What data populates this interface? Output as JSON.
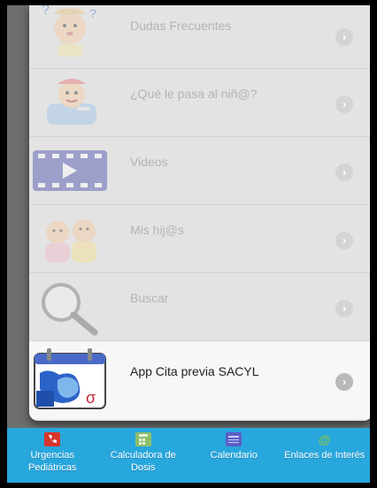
{
  "menu": {
    "items": [
      {
        "label": "Dudas Frecuentes",
        "icon": "baby-thinking-icon"
      },
      {
        "label": "¿Qué le pasa al niñ@?",
        "icon": "sick-baby-icon"
      },
      {
        "label": "Videos",
        "icon": "video-film-icon"
      },
      {
        "label": "Mis hij@s",
        "icon": "children-icon"
      },
      {
        "label": "Buscar",
        "icon": "magnifier-icon"
      },
      {
        "label": "App Cita previa SACYL",
        "icon": "calendar-appointment-icon"
      }
    ],
    "chevron": "›"
  },
  "tabbar": {
    "tabs": [
      {
        "label": "Urgencias Pediátricas",
        "icon": "phone-icon",
        "color": "#d9342b"
      },
      {
        "label": "Calculadora de Dosis",
        "icon": "calculator-icon",
        "color": "#8fbf6a"
      },
      {
        "label": "Calendario",
        "icon": "calendar-icon",
        "color": "#5b5fc7"
      },
      {
        "label": "Enlaces de Interés",
        "icon": "at-icon",
        "color": "#86c24d"
      }
    ]
  },
  "colors": {
    "tabbar_bg": "#28a7dd",
    "panel_bg": "#e6e6e6",
    "active_row_bg": "#f7f7f7"
  }
}
